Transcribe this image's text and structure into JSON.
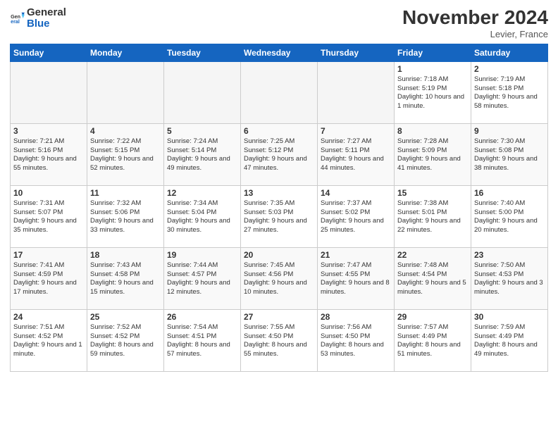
{
  "header": {
    "logo_general": "General",
    "logo_blue": "Blue",
    "month_year": "November 2024",
    "location": "Levier, France"
  },
  "weekdays": [
    "Sunday",
    "Monday",
    "Tuesday",
    "Wednesday",
    "Thursday",
    "Friday",
    "Saturday"
  ],
  "weeks": [
    [
      null,
      null,
      null,
      null,
      null,
      {
        "day": 1,
        "sunrise": "7:18 AM",
        "sunset": "5:19 PM",
        "daylight": "10 hours and 1 minute."
      },
      {
        "day": 2,
        "sunrise": "7:19 AM",
        "sunset": "5:18 PM",
        "daylight": "9 hours and 58 minutes."
      }
    ],
    [
      {
        "day": 3,
        "sunrise": "7:21 AM",
        "sunset": "5:16 PM",
        "daylight": "9 hours and 55 minutes."
      },
      {
        "day": 4,
        "sunrise": "7:22 AM",
        "sunset": "5:15 PM",
        "daylight": "9 hours and 52 minutes."
      },
      {
        "day": 5,
        "sunrise": "7:24 AM",
        "sunset": "5:14 PM",
        "daylight": "9 hours and 49 minutes."
      },
      {
        "day": 6,
        "sunrise": "7:25 AM",
        "sunset": "5:12 PM",
        "daylight": "9 hours and 47 minutes."
      },
      {
        "day": 7,
        "sunrise": "7:27 AM",
        "sunset": "5:11 PM",
        "daylight": "9 hours and 44 minutes."
      },
      {
        "day": 8,
        "sunrise": "7:28 AM",
        "sunset": "5:09 PM",
        "daylight": "9 hours and 41 minutes."
      },
      {
        "day": 9,
        "sunrise": "7:30 AM",
        "sunset": "5:08 PM",
        "daylight": "9 hours and 38 minutes."
      }
    ],
    [
      {
        "day": 10,
        "sunrise": "7:31 AM",
        "sunset": "5:07 PM",
        "daylight": "9 hours and 35 minutes."
      },
      {
        "day": 11,
        "sunrise": "7:32 AM",
        "sunset": "5:06 PM",
        "daylight": "9 hours and 33 minutes."
      },
      {
        "day": 12,
        "sunrise": "7:34 AM",
        "sunset": "5:04 PM",
        "daylight": "9 hours and 30 minutes."
      },
      {
        "day": 13,
        "sunrise": "7:35 AM",
        "sunset": "5:03 PM",
        "daylight": "9 hours and 27 minutes."
      },
      {
        "day": 14,
        "sunrise": "7:37 AM",
        "sunset": "5:02 PM",
        "daylight": "9 hours and 25 minutes."
      },
      {
        "day": 15,
        "sunrise": "7:38 AM",
        "sunset": "5:01 PM",
        "daylight": "9 hours and 22 minutes."
      },
      {
        "day": 16,
        "sunrise": "7:40 AM",
        "sunset": "5:00 PM",
        "daylight": "9 hours and 20 minutes."
      }
    ],
    [
      {
        "day": 17,
        "sunrise": "7:41 AM",
        "sunset": "4:59 PM",
        "daylight": "9 hours and 17 minutes."
      },
      {
        "day": 18,
        "sunrise": "7:43 AM",
        "sunset": "4:58 PM",
        "daylight": "9 hours and 15 minutes."
      },
      {
        "day": 19,
        "sunrise": "7:44 AM",
        "sunset": "4:57 PM",
        "daylight": "9 hours and 12 minutes."
      },
      {
        "day": 20,
        "sunrise": "7:45 AM",
        "sunset": "4:56 PM",
        "daylight": "9 hours and 10 minutes."
      },
      {
        "day": 21,
        "sunrise": "7:47 AM",
        "sunset": "4:55 PM",
        "daylight": "9 hours and 8 minutes."
      },
      {
        "day": 22,
        "sunrise": "7:48 AM",
        "sunset": "4:54 PM",
        "daylight": "9 hours and 5 minutes."
      },
      {
        "day": 23,
        "sunrise": "7:50 AM",
        "sunset": "4:53 PM",
        "daylight": "9 hours and 3 minutes."
      }
    ],
    [
      {
        "day": 24,
        "sunrise": "7:51 AM",
        "sunset": "4:52 PM",
        "daylight": "9 hours and 1 minute."
      },
      {
        "day": 25,
        "sunrise": "7:52 AM",
        "sunset": "4:52 PM",
        "daylight": "8 hours and 59 minutes."
      },
      {
        "day": 26,
        "sunrise": "7:54 AM",
        "sunset": "4:51 PM",
        "daylight": "8 hours and 57 minutes."
      },
      {
        "day": 27,
        "sunrise": "7:55 AM",
        "sunset": "4:50 PM",
        "daylight": "8 hours and 55 minutes."
      },
      {
        "day": 28,
        "sunrise": "7:56 AM",
        "sunset": "4:50 PM",
        "daylight": "8 hours and 53 minutes."
      },
      {
        "day": 29,
        "sunrise": "7:57 AM",
        "sunset": "4:49 PM",
        "daylight": "8 hours and 51 minutes."
      },
      {
        "day": 30,
        "sunrise": "7:59 AM",
        "sunset": "4:49 PM",
        "daylight": "8 hours and 49 minutes."
      }
    ]
  ]
}
